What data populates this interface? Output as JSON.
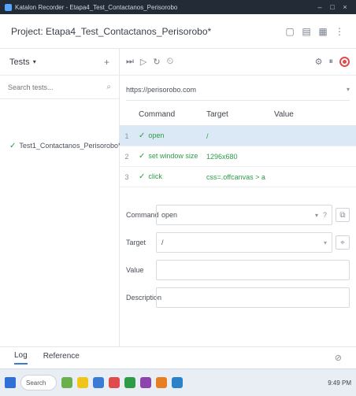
{
  "window": {
    "title": "Katalon Recorder - Etapa4_Test_Contactanos_Perisorobo"
  },
  "project": {
    "title": "Project: Etapa4_Test_Contactanos_Perisorobo*"
  },
  "sidebar": {
    "header_label": "Tests",
    "search_placeholder": "Search tests...",
    "tests": [
      {
        "label": "Test1_Contactanos_Perisorobo*"
      }
    ]
  },
  "main": {
    "url": "https://perisorobo.com",
    "table": {
      "columns": [
        "Command",
        "Target",
        "Value"
      ],
      "rows": [
        {
          "num": "1",
          "command": "open",
          "target": "/",
          "value": ""
        },
        {
          "num": "2",
          "command": "set window size",
          "target": "1296x680",
          "value": ""
        },
        {
          "num": "3",
          "command": "click",
          "target": "css=.offcanvas > a",
          "value": ""
        }
      ]
    },
    "editor": {
      "command_label": "Command",
      "command_value": "open",
      "target_label": "Target",
      "target_value": "/",
      "value_label": "Value",
      "description_label": "Description"
    }
  },
  "log": {
    "tabs": [
      "Log",
      "Reference"
    ]
  },
  "taskbar": {
    "search_label": "Search",
    "time": "9:49 PM"
  },
  "colors": {
    "accent": "#3a7bd5",
    "pass": "#2e9b47",
    "record": "#e04b4b",
    "selected": "#dbe8f6"
  }
}
